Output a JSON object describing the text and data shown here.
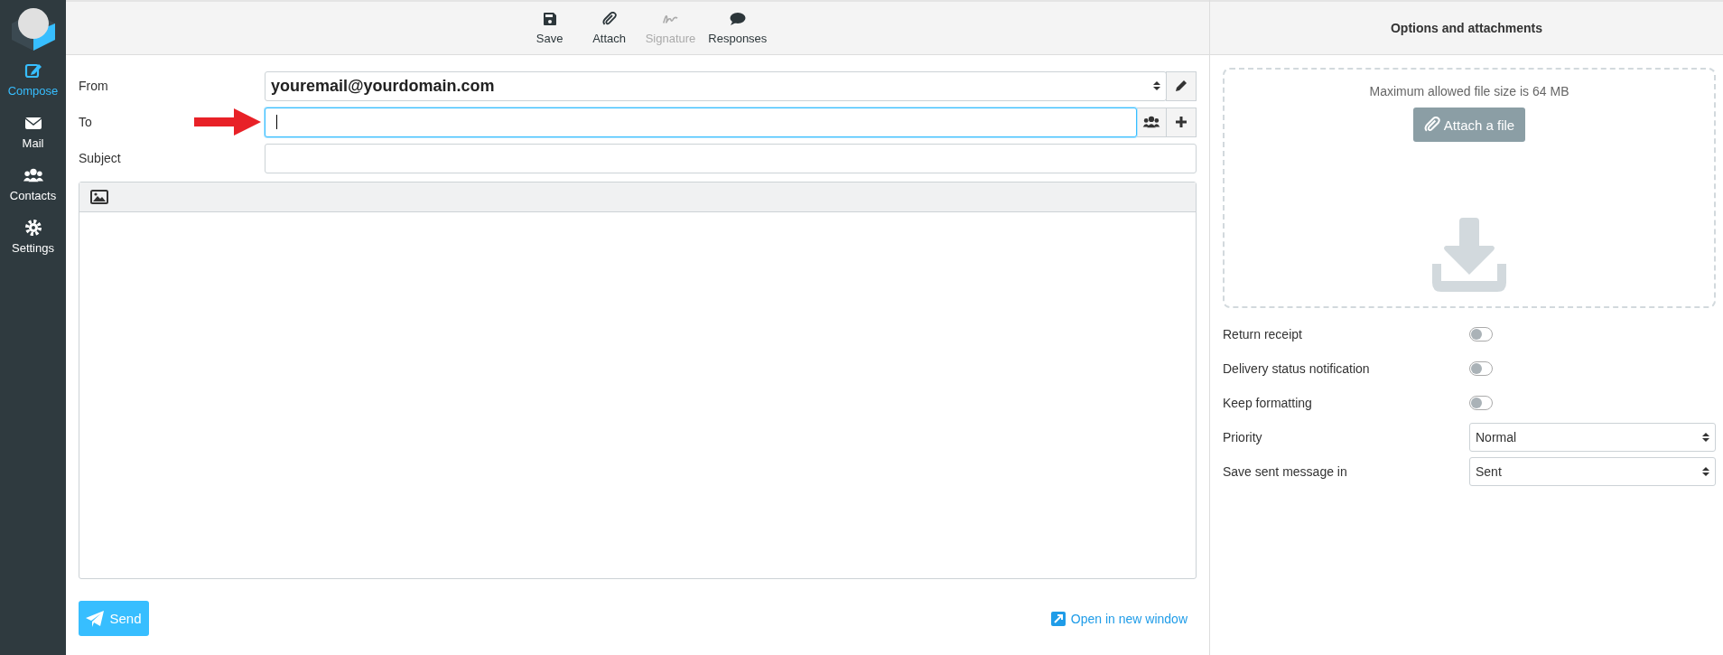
{
  "sidebar": {
    "items": [
      {
        "kind": "compose",
        "label": "Compose",
        "selected": true
      },
      {
        "kind": "mail",
        "label": "Mail",
        "selected": false
      },
      {
        "kind": "contacts",
        "label": "Contacts",
        "selected": false
      },
      {
        "kind": "settings",
        "label": "Settings",
        "selected": false
      }
    ]
  },
  "toolbar": [
    {
      "kind": "save",
      "label": "Save",
      "disabled": false
    },
    {
      "kind": "attach",
      "label": "Attach",
      "disabled": false
    },
    {
      "kind": "signature",
      "label": "Signature",
      "disabled": true
    },
    {
      "kind": "responses",
      "label": "Responses",
      "disabled": false
    }
  ],
  "form": {
    "from": {
      "label": "From",
      "value": "youremail@yourdomain.com"
    },
    "to": {
      "label": "To",
      "focused": true
    },
    "subject": {
      "label": "Subject"
    }
  },
  "send_button": "Send",
  "open_link": "Open in new window",
  "options": {
    "title": "Options and attachments",
    "dropzone": {
      "hint": "Maximum allowed file size is 64 MB",
      "button": "Attach a file"
    },
    "toggles": [
      {
        "label": "Return receipt",
        "on": false
      },
      {
        "label": "Delivery status notification",
        "on": false
      },
      {
        "label": "Keep formatting",
        "on": false
      }
    ],
    "selects": [
      {
        "label": "Priority",
        "value": "Normal"
      },
      {
        "label": "Save sent message in",
        "value": "Sent"
      }
    ]
  }
}
